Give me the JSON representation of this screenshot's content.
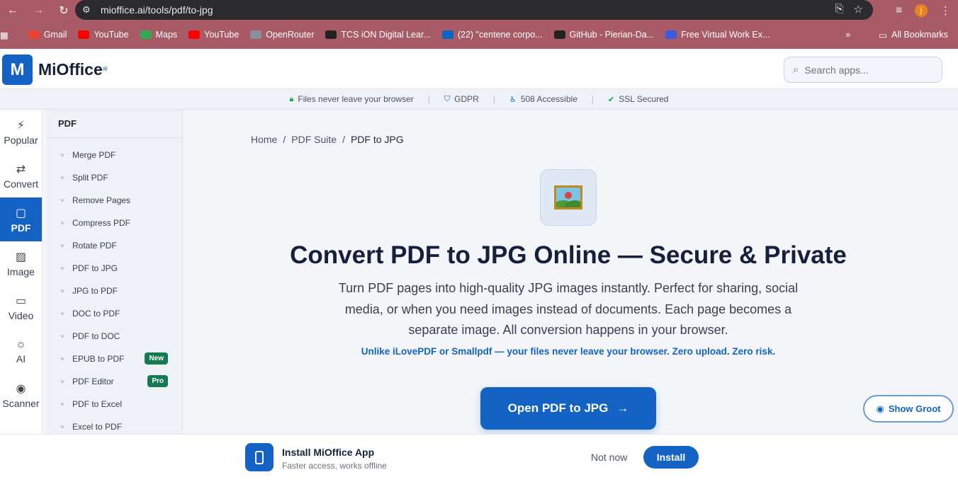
{
  "browser": {
    "url": "mioffice.ai/tools/pdf/to-jpg",
    "profile_initial": "j",
    "bookmarks": [
      {
        "label": "Gmail",
        "color": "#ea4335"
      },
      {
        "label": "YouTube",
        "color": "#ff0000"
      },
      {
        "label": "Maps",
        "color": "#34a853"
      },
      {
        "label": "YouTube",
        "color": "#ff0000"
      },
      {
        "label": "OpenRouter",
        "color": "#8a8fa0"
      },
      {
        "label": "TCS iON Digital Lear...",
        "color": "#222222"
      },
      {
        "label": "(22) \"centene corpo...",
        "color": "#0a66c2"
      },
      {
        "label": "GitHub - Pierian-Da...",
        "color": "#222222"
      },
      {
        "label": "Free Virtual Work Ex...",
        "color": "#3b5bdb"
      }
    ],
    "all_bookmarks": "All Bookmarks"
  },
  "app": {
    "brand": "MiOffice",
    "brand_sup": "ai",
    "search_placeholder": "Search apps..."
  },
  "trust": {
    "items": [
      "Files never leave your browser",
      "GDPR",
      "508 Accessible",
      "SSL Secured"
    ]
  },
  "rail": {
    "items": [
      {
        "label": "Popular",
        "icon": "⚡"
      },
      {
        "label": "Convert",
        "icon": "⇄"
      },
      {
        "label": "PDF",
        "icon": "▢"
      },
      {
        "label": "Image",
        "icon": "▨"
      },
      {
        "label": "Video",
        "icon": "▭"
      },
      {
        "label": "AI",
        "icon": "☼"
      },
      {
        "label": "Scanner",
        "icon": "◉"
      }
    ]
  },
  "subnav": {
    "title": "PDF",
    "items": [
      {
        "label": "Merge PDF",
        "badge": ""
      },
      {
        "label": "Split PDF",
        "badge": ""
      },
      {
        "label": "Remove Pages",
        "badge": ""
      },
      {
        "label": "Compress PDF",
        "badge": ""
      },
      {
        "label": "Rotate PDF",
        "badge": ""
      },
      {
        "label": "PDF to JPG",
        "badge": ""
      },
      {
        "label": "JPG to PDF",
        "badge": ""
      },
      {
        "label": "DOC to PDF",
        "badge": ""
      },
      {
        "label": "PDF to DOC",
        "badge": ""
      },
      {
        "label": "EPUB to PDF",
        "badge": "New"
      },
      {
        "label": "PDF Editor",
        "badge": "Pro"
      },
      {
        "label": "PDF to Excel",
        "badge": ""
      },
      {
        "label": "Excel to PDF",
        "badge": ""
      }
    ]
  },
  "breadcrumb": {
    "home": "Home",
    "suite": "PDF Suite",
    "current": "PDF to JPG",
    "sep": "/"
  },
  "hero": {
    "title": "Convert PDF to JPG Online — Secure & Private",
    "description": "Turn PDF pages into high-quality JPG images instantly. Perfect for sharing, social media, or when you need images instead of documents. Each page becomes a separate image. All conversion happens in your browser.",
    "note": "Unlike iLovePDF or Smallpdf — your files never leave your browser. Zero upload. Zero risk.",
    "cta": "Open PDF to JPG",
    "cta_arrow": "→"
  },
  "groot": {
    "label": "Show Groot"
  },
  "install": {
    "title": "Install MiOffice App",
    "subtitle": "Faster access, works offline",
    "dismiss": "Not now",
    "install": "Install"
  }
}
